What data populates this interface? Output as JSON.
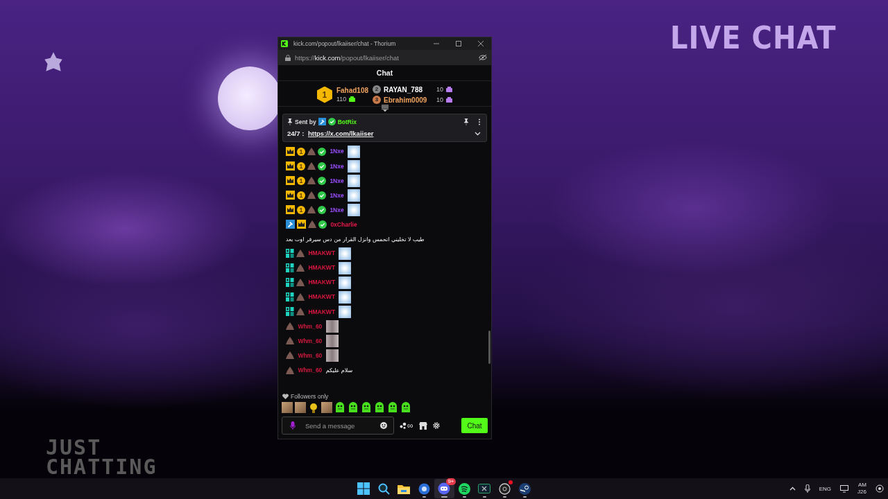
{
  "desktop": {
    "overlay_title": "LIVE CHAT",
    "overlay_category": "JUST CHATTING"
  },
  "window": {
    "title": "kick.com/popout/lkaiiser/chat - Thorium",
    "url": {
      "scheme": "https://",
      "domain": "kick.com",
      "path": "/popout/lkaiiser/chat"
    },
    "header": "Chat"
  },
  "leaderboard": {
    "top": {
      "rank": "1",
      "name": "Fahad108",
      "count": "110"
    },
    "others": [
      {
        "rank": "2",
        "name": "RAYAN_788",
        "count": "10",
        "color": "#ffffff"
      },
      {
        "rank": "3",
        "name": "Ebrahim0009",
        "count": "10",
        "color": "#f0a35e"
      }
    ]
  },
  "pinned": {
    "label": "Sent by",
    "sender": "BotRix",
    "text": "24/7 : ",
    "link": "https://x.com/lkaiiser"
  },
  "messages": [
    {
      "user": "1Nxe",
      "color": "#9b4dff",
      "badges": [
        {
          "kind": "crown"
        },
        {
          "kind": "coin",
          "label": "1"
        },
        {
          "kind": "pile"
        },
        {
          "kind": "verified"
        }
      ],
      "kind": "emote",
      "emote": {
        "kind": "cloud"
      }
    },
    {
      "user": "1Nxe",
      "color": "#9b4dff",
      "badges": [
        {
          "kind": "crown"
        },
        {
          "kind": "coin",
          "label": "1"
        },
        {
          "kind": "pile"
        },
        {
          "kind": "verified"
        }
      ],
      "kind": "emote",
      "emote": {
        "kind": "cloud"
      }
    },
    {
      "user": "1Nxe",
      "color": "#9b4dff",
      "badges": [
        {
          "kind": "crown"
        },
        {
          "kind": "coin",
          "label": "1"
        },
        {
          "kind": "pile"
        },
        {
          "kind": "verified"
        }
      ],
      "kind": "emote",
      "emote": {
        "kind": "cloud"
      }
    },
    {
      "user": "1Nxe",
      "color": "#9b4dff",
      "badges": [
        {
          "kind": "crown"
        },
        {
          "kind": "coin",
          "label": "1"
        },
        {
          "kind": "pile"
        },
        {
          "kind": "verified"
        }
      ],
      "kind": "emote",
      "emote": {
        "kind": "cloud"
      }
    },
    {
      "user": "1Nxe",
      "color": "#9b4dff",
      "badges": [
        {
          "kind": "crown"
        },
        {
          "kind": "coin",
          "label": "1"
        },
        {
          "kind": "pile"
        },
        {
          "kind": "verified"
        }
      ],
      "kind": "emote",
      "emote": {
        "kind": "cloud"
      }
    },
    {
      "user": "0xCharlie",
      "color": "#e8194b",
      "badges": [
        {
          "kind": "hammer"
        },
        {
          "kind": "crown"
        },
        {
          "kind": "pile"
        },
        {
          "kind": "verified"
        }
      ],
      "kind": "text",
      "text": "طيب لا تخليني اتحمس وانزل القرار من دس سيرفر اوت بعد"
    },
    {
      "user": "HMAKWT",
      "color": "#d8163f",
      "badges": [
        {
          "kind": "og"
        },
        {
          "kind": "pile"
        }
      ],
      "kind": "emote",
      "emote": {
        "kind": "cloud"
      }
    },
    {
      "user": "HMAKWT",
      "color": "#d8163f",
      "badges": [
        {
          "kind": "og"
        },
        {
          "kind": "pile"
        }
      ],
      "kind": "emote",
      "emote": {
        "kind": "cloud"
      }
    },
    {
      "user": "HMAKWT",
      "color": "#d8163f",
      "badges": [
        {
          "kind": "og"
        },
        {
          "kind": "pile"
        }
      ],
      "kind": "emote",
      "emote": {
        "kind": "cloud"
      }
    },
    {
      "user": "HMAKWT",
      "color": "#d8163f",
      "badges": [
        {
          "kind": "og"
        },
        {
          "kind": "pile"
        }
      ],
      "kind": "emote",
      "emote": {
        "kind": "cloud"
      }
    },
    {
      "user": "HMAKWT",
      "color": "#d8163f",
      "badges": [
        {
          "kind": "og"
        },
        {
          "kind": "pile"
        }
      ],
      "kind": "emote",
      "emote": {
        "kind": "cloud"
      }
    },
    {
      "user": "Whm_60",
      "color": "#cf1a3d",
      "badges": [
        {
          "kind": "pile"
        }
      ],
      "kind": "emote",
      "emote": {
        "kind": "figure"
      }
    },
    {
      "user": "Whm_60",
      "color": "#cf1a3d",
      "badges": [
        {
          "kind": "pile"
        }
      ],
      "kind": "emote",
      "emote": {
        "kind": "figure"
      }
    },
    {
      "user": "Whm_60",
      "color": "#cf1a3d",
      "badges": [
        {
          "kind": "pile"
        }
      ],
      "kind": "emote",
      "emote": {
        "kind": "figure"
      }
    },
    {
      "user": "Whm_60",
      "color": "#cf1a3d",
      "badges": [
        {
          "kind": "pile"
        }
      ],
      "kind": "text",
      "text": "سلام عليكم"
    }
  ],
  "footer": {
    "mode": "Followers only",
    "emote_strip": [
      {
        "kind": "photo"
      },
      {
        "kind": "photo"
      },
      {
        "kind": "figure"
      },
      {
        "kind": "photo"
      },
      {
        "kind": "frog"
      },
      {
        "kind": "frog"
      },
      {
        "kind": "frog"
      },
      {
        "kind": "frog"
      },
      {
        "kind": "frog"
      },
      {
        "kind": "frog"
      }
    ],
    "placeholder": "Send a message",
    "points": "∞",
    "send_button": "Chat"
  },
  "taskbar": {
    "apps": [
      {
        "kind": "start",
        "running": false,
        "selected": false
      },
      {
        "kind": "search",
        "running": false,
        "selected": false
      },
      {
        "kind": "folder",
        "running": false,
        "selected": false
      },
      {
        "kind": "browser",
        "running": true,
        "selected": false
      },
      {
        "kind": "chat",
        "running": true,
        "selected": true,
        "badge": "9+"
      },
      {
        "kind": "music",
        "running": true,
        "selected": false
      },
      {
        "kind": "xbox",
        "running": true,
        "selected": false
      },
      {
        "kind": "recorder",
        "running": true,
        "selected": false,
        "alert": true
      },
      {
        "kind": "steam",
        "running": true,
        "selected": false
      }
    ],
    "tray": {
      "language": "ENG",
      "time": "AM",
      "date": "J26"
    }
  }
}
